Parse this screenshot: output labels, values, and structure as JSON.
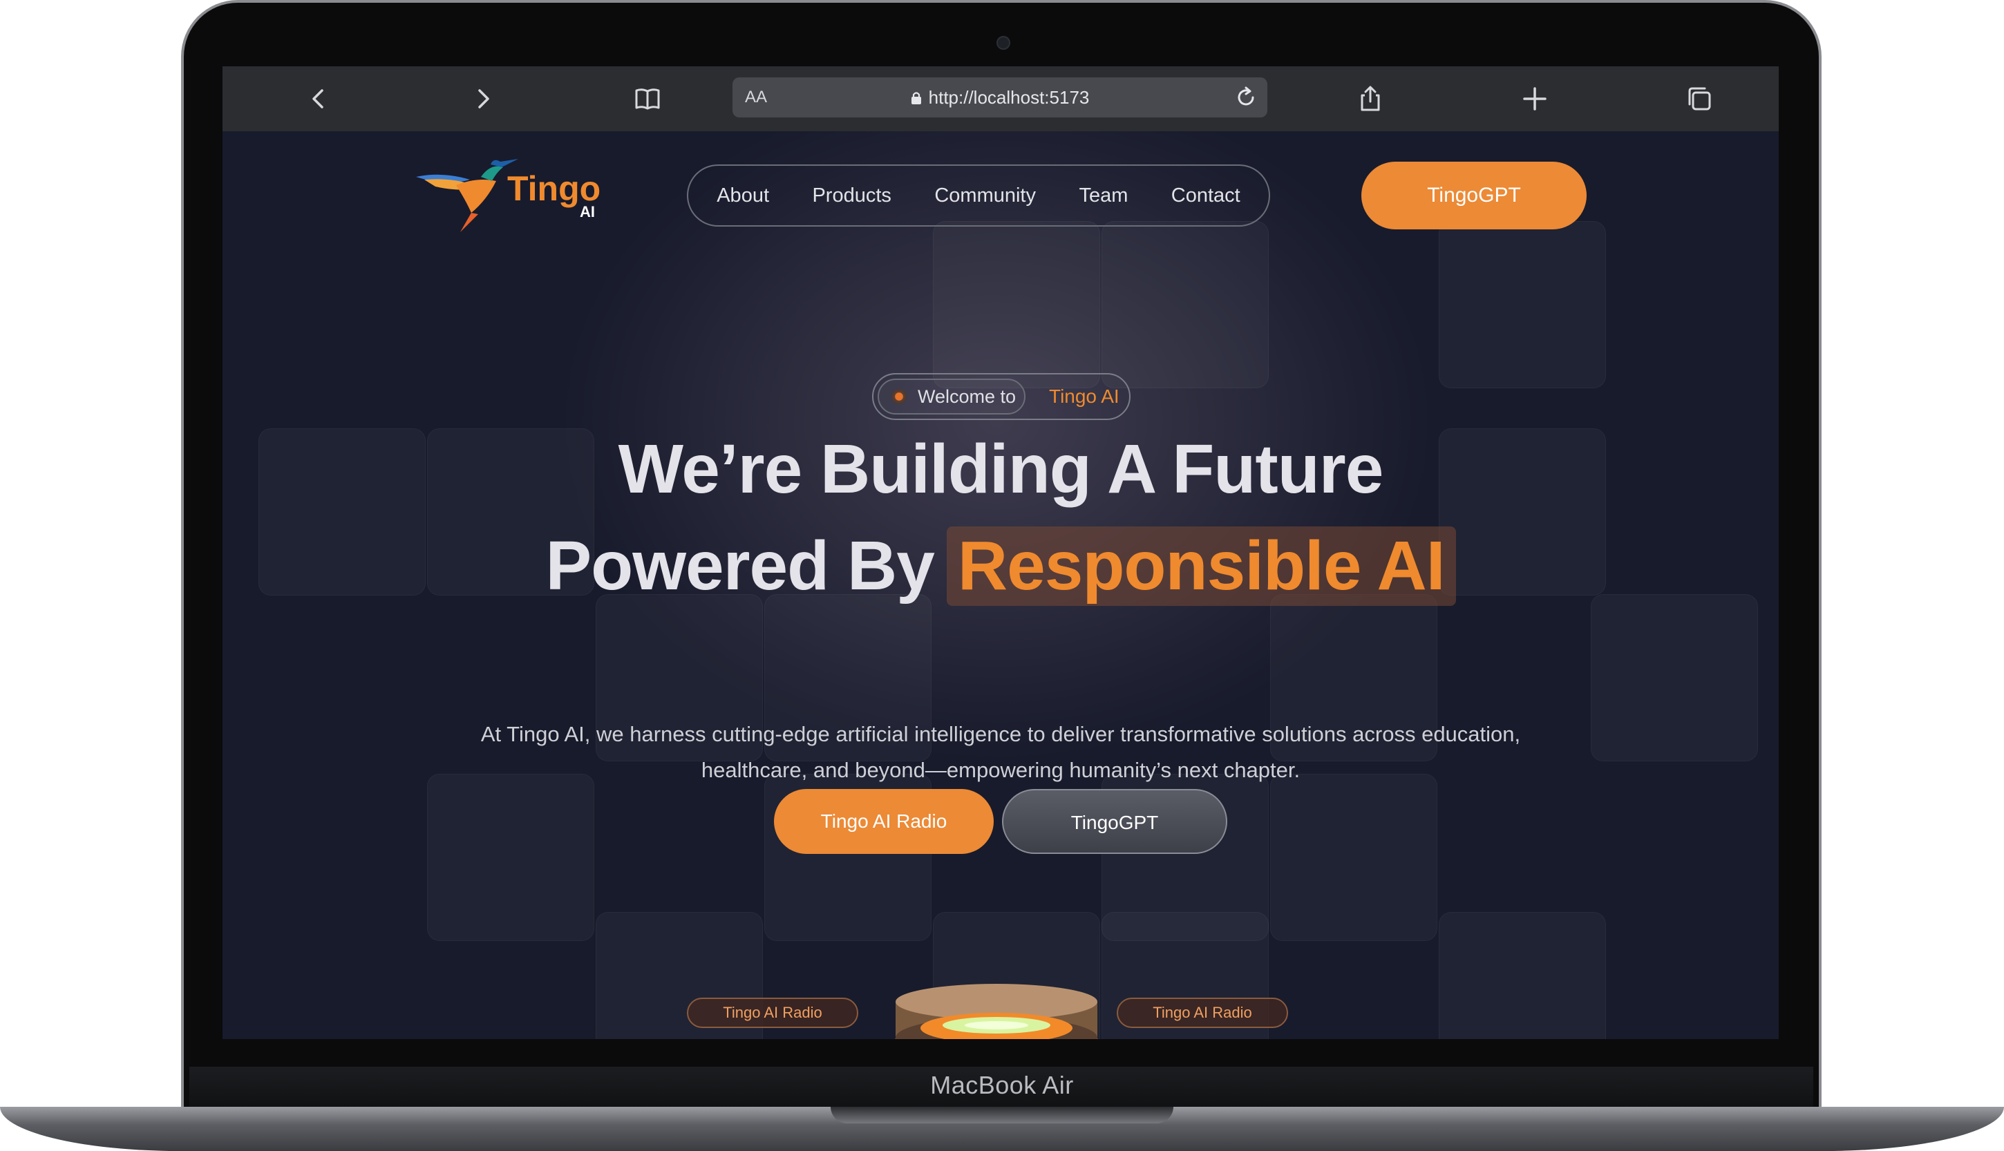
{
  "device": {
    "model_label": "MacBook Air"
  },
  "browser": {
    "reader_label": "AA",
    "url": "http://localhost:5173",
    "icons": {
      "back": "chevron-left-icon",
      "forward": "chevron-right-icon",
      "bookmarks": "book-icon",
      "lock": "lock-icon",
      "reload": "reload-icon",
      "share": "share-icon",
      "new_tab": "plus-icon",
      "tabs": "tabs-icon"
    }
  },
  "site": {
    "logo_text": "Tingo",
    "logo_sub": "AI",
    "nav": [
      "About",
      "Products",
      "Community",
      "Team",
      "Contact"
    ],
    "cta_top": "TingoGPT",
    "welcome": {
      "prefix": "Welcome to",
      "brand": "Tingo AI"
    },
    "headline_line1": "We’re Building A Future",
    "headline_line2_prefix": "Powered By",
    "headline_line2_highlight": "Responsible AI",
    "subtext": "At Tingo AI, we harness cutting-edge artificial intelligence to deliver transformative solutions across education, healthcare, and beyond—empowering humanity’s next chapter.",
    "primary_button": "Tingo AI Radio",
    "secondary_button": "TingoGPT",
    "tag_left": "Tingo AI Radio",
    "tag_right": "Tingo AI Radio",
    "colors": {
      "accent": "#ec8a36",
      "background": "#181b2c",
      "text": "#e4e3ea"
    }
  }
}
